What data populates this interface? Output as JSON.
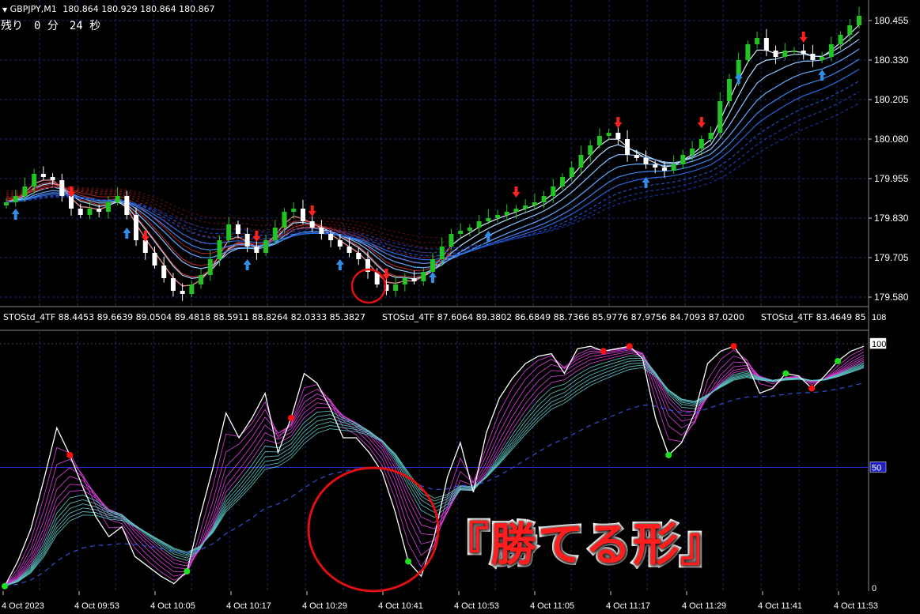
{
  "window": {
    "symbol_timeframe": "GBPJPY,M1",
    "ohlc": "180.864 180.929 180.864 180.867",
    "countdown": "残り　0 分　24 秒"
  },
  "price_axis": [
    "180.455",
    "180.330",
    "180.205",
    "180.080",
    "179.955",
    "179.830",
    "179.705",
    "179.580"
  ],
  "indicator": {
    "header": [
      "STOStd_4TF 88.4453 89.6639 89.0504 89.4818 88.5911 88.8264 82.0333 85.3827",
      "STOStd_4TF 87.6064 89.3802 86.6849 88.7366 85.9776 87.9756 84.7093 87.0200",
      "STOStd_4TF 83.4649 85"
    ],
    "scale_top": "108",
    "level_100": "100",
    "level_50": "50",
    "level_0": "0"
  },
  "time_axis": [
    "4 Oct 2023",
    "4 Oct 09:53",
    "4 Oct 10:05",
    "4 Oct 10:17",
    "4 Oct 10:29",
    "4 Oct 10:41",
    "4 Oct 10:53",
    "4 Oct 11:05",
    "4 Oct 11:17",
    "4 Oct 11:29",
    "4 Oct 11:41",
    "4 Oct 11:53"
  ],
  "annotation": "『勝てる形』",
  "colors": {
    "background": "#000000",
    "grid": "#1c2a6e",
    "bull_candle": "#22c322",
    "bear_candle": "#ffffff",
    "ma_bull": "#4aa8ff",
    "ma_bear": "#e02020",
    "stoch_main": "#ffffff",
    "stoch_magenta": "#e040e0",
    "stoch_teal": "#5fc8c8",
    "signal_up": "#2f8fe8",
    "signal_down": "#ff2020",
    "dot_red": "#ff1010",
    "dot_green": "#1ee01e",
    "circle": "#e01010",
    "level_line": "#2a2ad0"
  },
  "chart_data": {
    "type": "candlestick",
    "symbol": "GBPJPY",
    "timeframe": "M1",
    "price_ylim": [
      179.55,
      180.49
    ],
    "close_prices": [
      179.88,
      179.9,
      179.93,
      179.97,
      179.96,
      179.95,
      179.9,
      179.86,
      179.84,
      179.86,
      179.85,
      179.88,
      179.9,
      179.84,
      179.76,
      179.72,
      179.68,
      179.64,
      179.6,
      179.59,
      179.62,
      179.65,
      179.7,
      179.76,
      179.81,
      179.78,
      179.74,
      179.72,
      179.76,
      179.8,
      179.85,
      179.86,
      179.82,
      179.8,
      179.78,
      179.76,
      179.74,
      179.72,
      179.7,
      179.66,
      179.62,
      179.6,
      179.62,
      179.64,
      179.63,
      179.66,
      179.7,
      179.74,
      179.78,
      179.79,
      179.8,
      179.82,
      179.83,
      179.84,
      179.85,
      179.86,
      179.87,
      179.88,
      179.9,
      179.93,
      179.96,
      179.99,
      180.03,
      180.06,
      180.09,
      180.1,
      180.08,
      180.03,
      180.02,
      180.0,
      179.99,
      179.98,
      180.0,
      180.03,
      180.05,
      180.08,
      180.1,
      180.2,
      180.27,
      180.33,
      180.38,
      180.4,
      180.36,
      180.34,
      180.36,
      180.36,
      180.35,
      180.33,
      180.34,
      180.38,
      180.41,
      180.44,
      180.47
    ],
    "stoch_ylim": [
      0,
      108
    ],
    "stoch_main": [
      2,
      12,
      25,
      45,
      66,
      55,
      42,
      30,
      22,
      26,
      14,
      10,
      6,
      3,
      8,
      30,
      50,
      72,
      62,
      70,
      80,
      56,
      70,
      88,
      84,
      74,
      62,
      62,
      56,
      48,
      32,
      12,
      6,
      22,
      46,
      60,
      40,
      64,
      78,
      86,
      92,
      95,
      96,
      88,
      98,
      99,
      97,
      98,
      99,
      94,
      70,
      55,
      60,
      72,
      92,
      97,
      99,
      92,
      80,
      82,
      88,
      87,
      82,
      87,
      93,
      97,
      99
    ]
  }
}
